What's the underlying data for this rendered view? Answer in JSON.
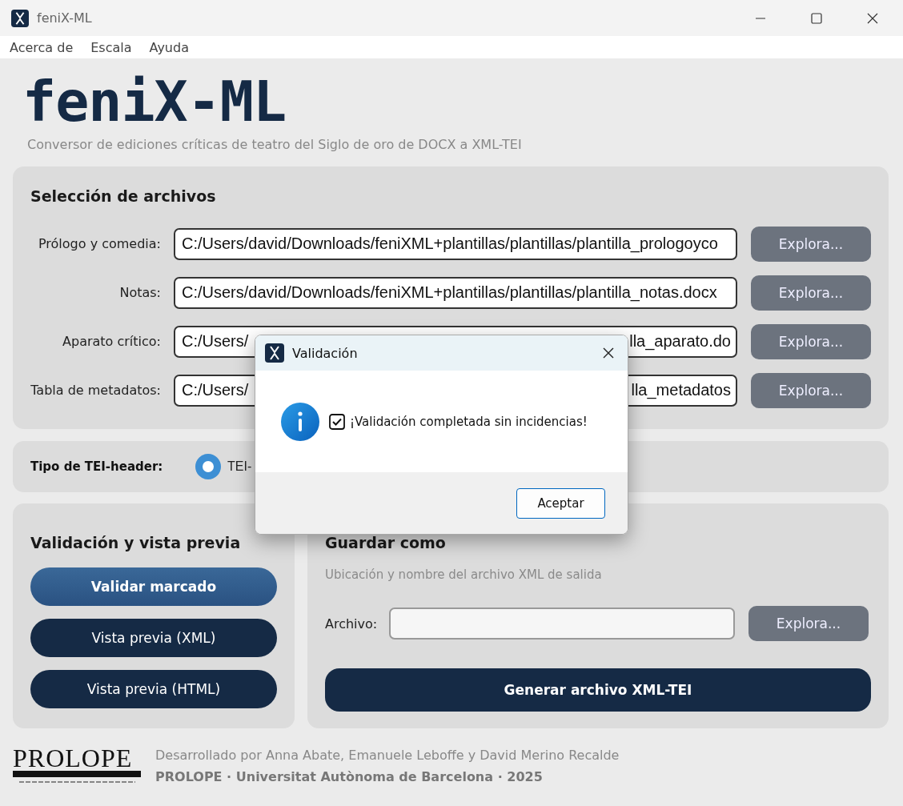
{
  "window": {
    "title": "feniX-ML"
  },
  "menu": [
    "Acerca de",
    "Escala",
    "Ayuda"
  ],
  "header": {
    "logo": "feniX-ML",
    "subtitle": "Conversor de ediciones críticas de teatro del Siglo de oro de DOCX a XML-TEI"
  },
  "file_selection": {
    "title": "Selección de archivos",
    "rows": [
      {
        "label": "Prólogo y comedia:",
        "value": "C:/Users/david/Downloads/feniXML+plantillas/plantillas/plantilla_prologoyco",
        "button": "Explora..."
      },
      {
        "label": "Notas:",
        "value": "C:/Users/david/Downloads/feniXML+plantillas/plantillas/plantilla_notas.docx",
        "button": "Explora..."
      },
      {
        "label": "Aparato crítico:",
        "value": "C:/Users/",
        "value_end": "lla_aparato.do",
        "button": "Explora..."
      },
      {
        "label": "Tabla de metadatos:",
        "value": "C:/Users/",
        "value_end": "lla_metadatos",
        "button": "Explora..."
      }
    ]
  },
  "tei_header": {
    "label": "Tipo de TEI-header:",
    "options": [
      {
        "label": "TEI-",
        "selected": true
      }
    ]
  },
  "validation": {
    "title": "Validación y vista previa",
    "buttons": [
      {
        "label": "Validar marcado",
        "highlighted": true
      },
      {
        "label": "Vista previa (XML)",
        "highlighted": false
      },
      {
        "label": "Vista previa (HTML)",
        "highlighted": false
      }
    ]
  },
  "save_as": {
    "title": "Guardar como",
    "hint": "Ubicación y nombre del archivo XML de salida",
    "field_label": "Archivo:",
    "button": "Explora...",
    "generate": "Generar archivo XML-TEI"
  },
  "footer": {
    "logo": "PROLOPE",
    "credits": "Desarrollado por Anna Abate, Emanuele Leboffe y David Merino Recalde",
    "institution": "PROLOPE · Universitat Autònoma de Barcelona · 2025"
  },
  "dialog": {
    "title": "Validación",
    "message": "¡Validación completada sin incidencias!",
    "checked": true,
    "button": "Aceptar"
  }
}
